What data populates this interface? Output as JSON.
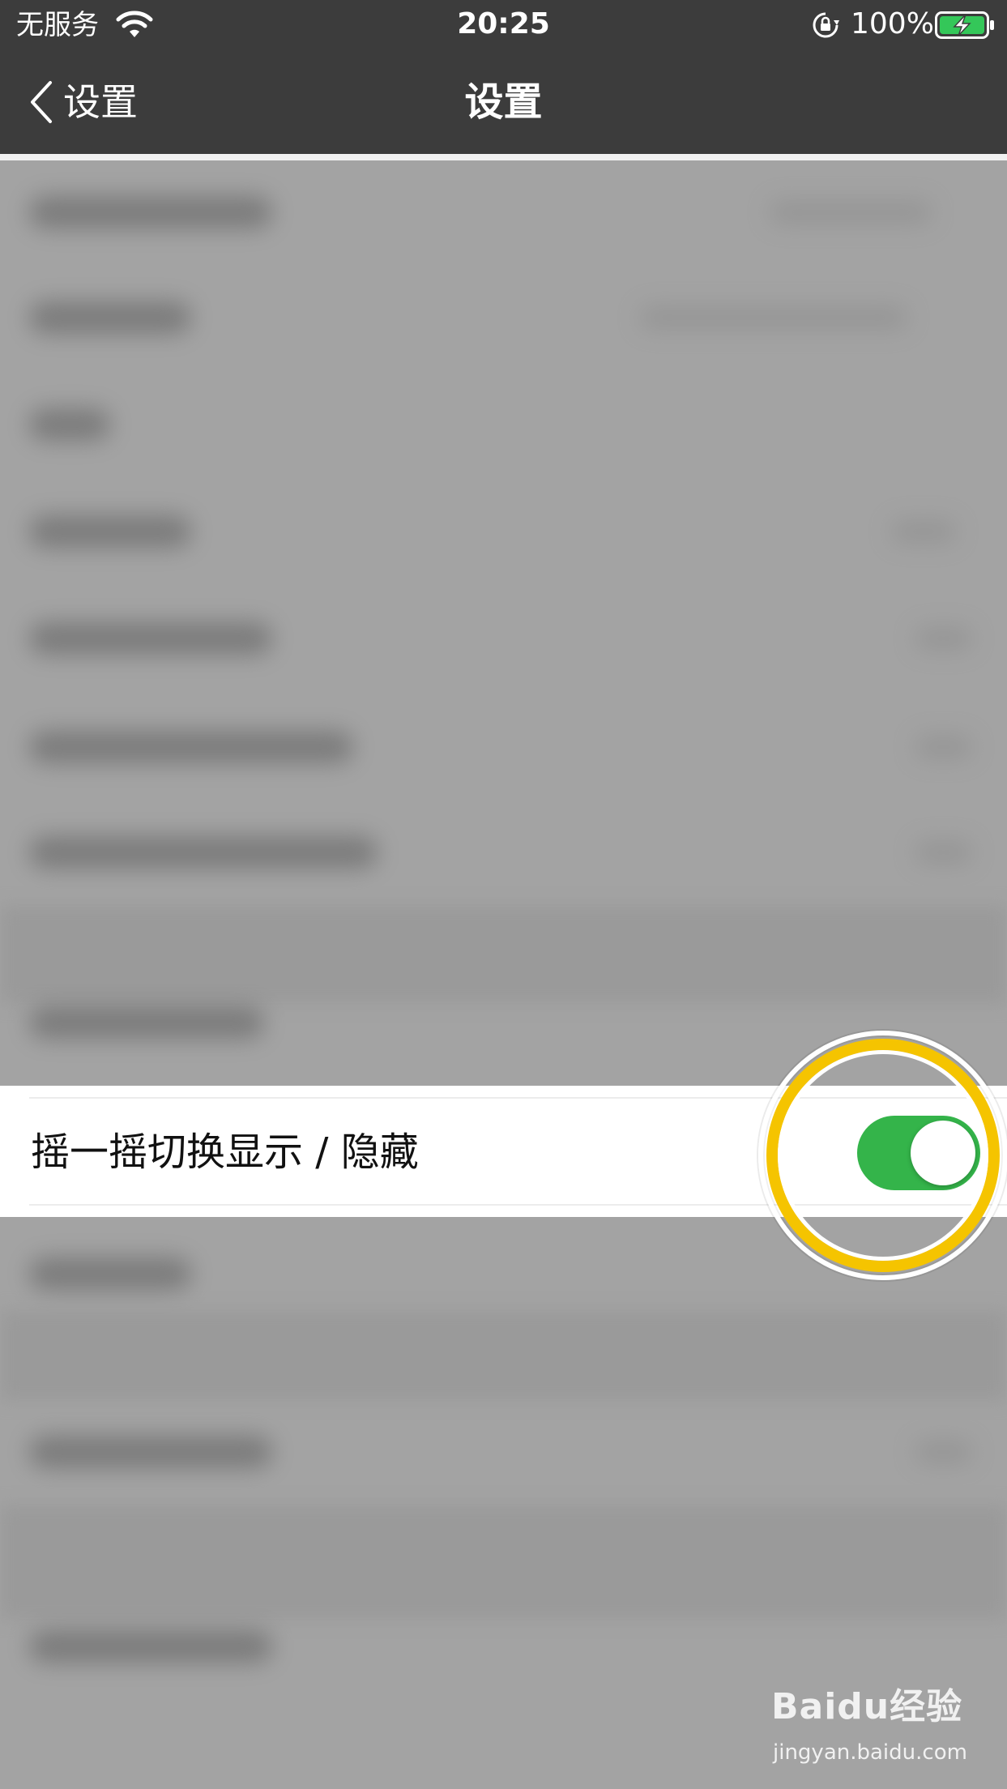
{
  "status_bar": {
    "carrier": "无服务",
    "time": "20:25",
    "battery_percent": "100%",
    "icons": [
      "wifi-icon",
      "orientation-lock-icon",
      "battery-charging-icon"
    ]
  },
  "nav": {
    "back_label": "设置",
    "title": "设置"
  },
  "highlighted_row": {
    "label": "摇一摇切换显示 / 隐藏",
    "toggle_on": true
  },
  "colors": {
    "bar_background": "#3c3c3c",
    "toggle_on": "#34b44a",
    "highlight_ring": "#f5c400",
    "dimmed_background": "#a3a3a3"
  },
  "watermark": {
    "logo": "Baidu经验",
    "url": "jingyan.baidu.com"
  }
}
